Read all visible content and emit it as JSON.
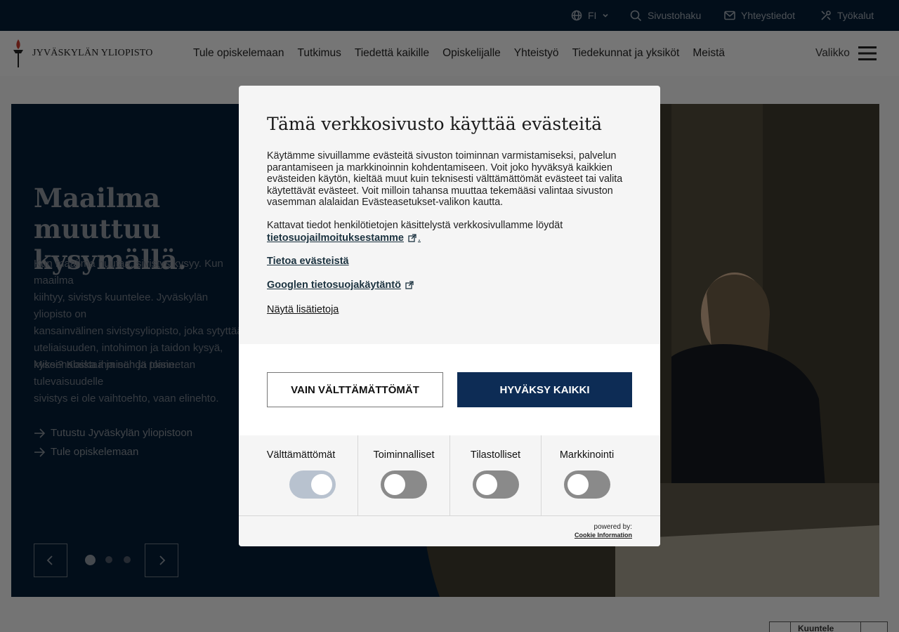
{
  "topbar": {
    "language": "FI",
    "search_label": "Sivustohaku",
    "contact_label": "Yhteystiedot",
    "tools_label": "Työkalut"
  },
  "header": {
    "logo_text": "JYVÄSKYLÄN YLIOPISTO",
    "nav": [
      "Tule opiskelemaan",
      "Tutkimus",
      "Tiedettä kaikille",
      "Opiskelijalle",
      "Yhteistyö",
      "Tiedekunnat ja yksiköt",
      "Meistä"
    ],
    "menu_label": "Valikko"
  },
  "hero": {
    "title": "Maailma muuttuu\nkysymällä.",
    "body1": "Kun maailma huutaa, sivistys kysyy. Kun maailma\nkiihtyy, sivistys kuuntelee. Jyväskylän yliopisto on\nkansainvälinen sivistysyliopisto, joka sytyttää\nuteliaisuuden, intohimon ja taidon kysyä,\nkyseenalaistaa ja nähdä toisin.",
    "body2": "Miksi? Koska ihmisen ja planeetan tulevaisuudelle\nsivistys ei ole vaihtoehto, vaan elinehto.",
    "links": [
      "Tutustu Jyväskylän yliopistoon",
      "Tule opiskelemaan"
    ],
    "slides": 3,
    "active_slide": 1
  },
  "speak": {
    "label": "Kuuntele"
  },
  "cookie_modal": {
    "title": "Tämä verkkosivusto käyttää evästeitä",
    "paragraph1": "Käytämme sivuillamme evästeitä sivuston toiminnan varmistamiseksi, palvelun parantamiseen ja markkinoinnin kohdentamiseen. Voit joko hyväksyä kaikkien evästeiden käytön, kieltää muut kuin teknisesti välttämättömät evästeet tai valita käytettävät evästeet. Voit milloin tahansa muuttaa tekemääsi valintaa sivuston vasemman alalaidan Evästeasetukset-valikon kautta.",
    "paragraph2": "Kattavat tiedot henkilötietojen käsittelystä verkkosivullamme löydät",
    "privacy_link": "tietosuojailmoituksestamme",
    "about_link": "Tietoa evästeistä",
    "google_link": "Googlen tietosuojakäytäntö",
    "more_link": "Näytä lisätietoja",
    "btn_necessary": "Vain välttämättömät",
    "btn_accept": "Hyväksy kaikki",
    "categories": [
      {
        "label": "Välttämättömät",
        "enabled": true,
        "locked": true
      },
      {
        "label": "Toiminnalliset",
        "enabled": false,
        "locked": false
      },
      {
        "label": "Tilastolliset",
        "enabled": false,
        "locked": false
      },
      {
        "label": "Markkinointi",
        "enabled": false,
        "locked": false
      }
    ],
    "powered_by": "powered by:",
    "powered_link": "Cookie Information"
  },
  "colors": {
    "navy": "#041c34",
    "primary_button": "#0d2c55",
    "toggle_off": "#8a8a8a",
    "toggle_locked": "#b8c2cf"
  }
}
